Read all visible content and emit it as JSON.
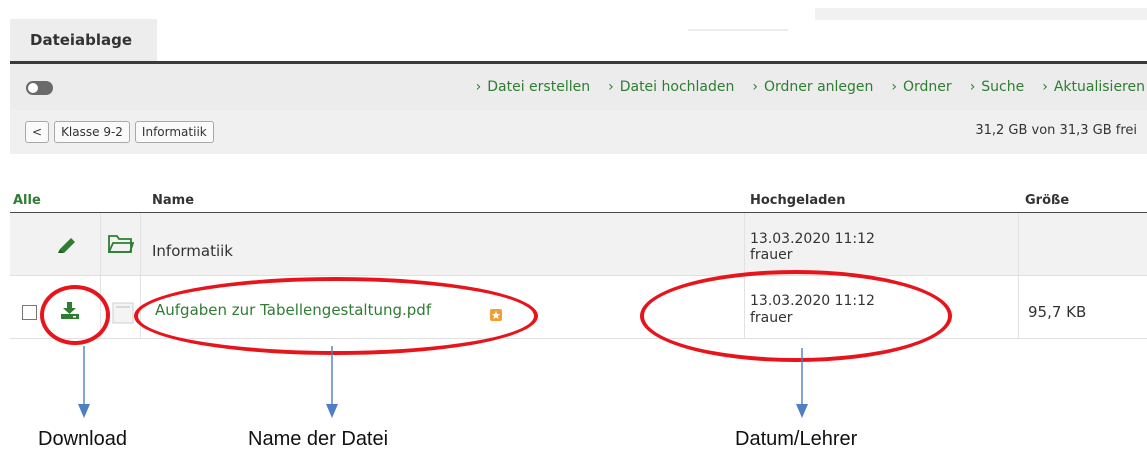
{
  "tab": {
    "label": "Dateiablage"
  },
  "toolbar": {
    "actions": [
      "Datei erstellen",
      "Datei hochladen",
      "Ordner anlegen",
      "Ordner",
      "Suche",
      "Aktualisieren"
    ]
  },
  "pathbar": {
    "back_label": "<",
    "crumbs": [
      "Klasse 9-2",
      "Informatiik"
    ],
    "free_space": "31,2 GB von 31,3 GB frei"
  },
  "table": {
    "headers": {
      "select_all": "Alle",
      "name": "Name",
      "uploaded": "Hochgeladen",
      "size": "Größe"
    },
    "rows": [
      {
        "name": "Informatiik",
        "date": "13.03.2020 11:12",
        "user": "frauer",
        "size": ""
      },
      {
        "name": "Aufgaben zur Tabellengestaltung.pdf",
        "date": "13.03.2020 11:12",
        "user": "frauer",
        "size": "95,7 KB"
      }
    ]
  },
  "annotations": {
    "download": "Download",
    "filename": "Name der Datei",
    "date_teacher": "Datum/Lehrer"
  },
  "colors": {
    "accent": "#2e7d32",
    "annotation_red": "#e8141b",
    "arrow_blue": "#4f7ec3"
  }
}
